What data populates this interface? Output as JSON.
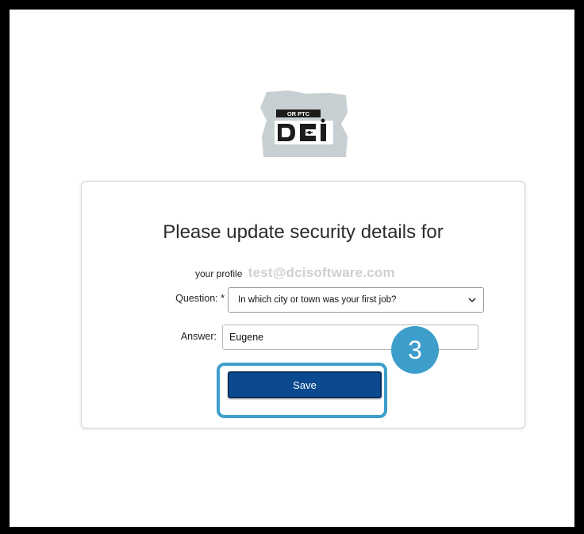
{
  "logo": {
    "badge_text": "OR PTC",
    "wordmark": "DCI"
  },
  "card": {
    "title": "Please update security details for",
    "profile_label": "your profile",
    "profile_email": "test@dcisoftware.com",
    "question_label": "Question: *",
    "question_value": "In which city or town was your first job?",
    "answer_label": "Answer:",
    "answer_value": "Eugene",
    "save_label": "Save"
  },
  "annotation": {
    "step_number": "3"
  },
  "colors": {
    "button": "#0b4a8f",
    "annotation": "#3d9ecb",
    "background_frame": "#000000"
  }
}
